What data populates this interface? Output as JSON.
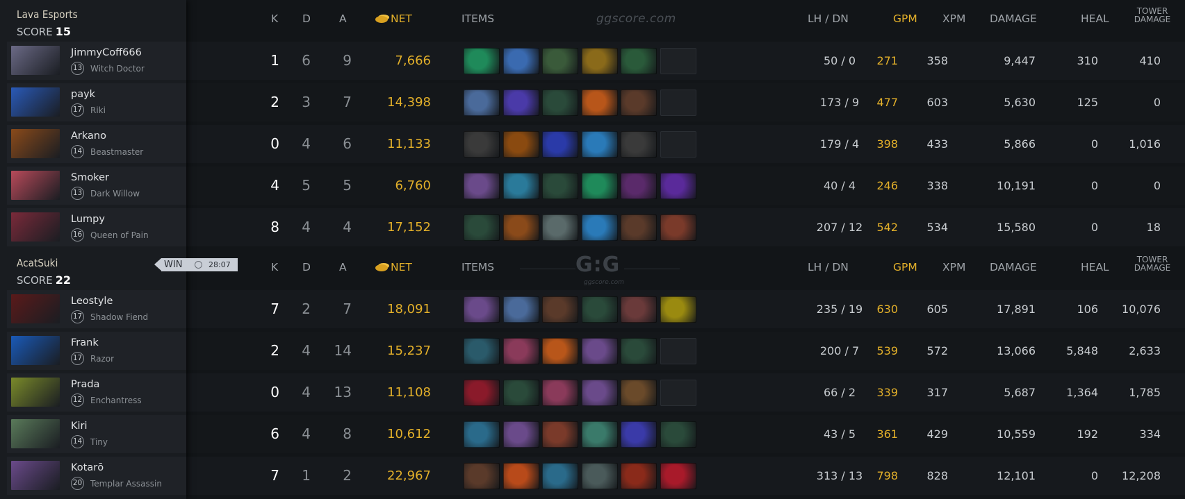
{
  "watermark_text": "ggscore.com",
  "watermark_logo": "G:G",
  "watermark_logo_sub": "ggscore.com",
  "headers": {
    "k": "K",
    "d": "D",
    "a": "A",
    "net": "NET",
    "items": "ITEMS",
    "lh_dn": "LH  /  DN",
    "gpm": "GPM",
    "xpm": "XPM",
    "damage": "DAMAGE",
    "heal": "HEAL",
    "tower_line1": "TOWER",
    "tower_line2": "DAMAGE"
  },
  "win_badge": {
    "label": "WIN",
    "duration": "28:07"
  },
  "teams": [
    {
      "name": "Lava Esports",
      "score_label": "SCORE",
      "score": "15",
      "players": [
        {
          "name": "JimmyCoff666",
          "level": "13",
          "hero": "Witch Doctor",
          "portrait_color": "#6b6a86",
          "k": "1",
          "d": "6",
          "a": "9",
          "net": "7,666",
          "lh_dn": "50  /  0",
          "gpm": "271",
          "xpm": "358",
          "damage": "9,447",
          "heal": "310",
          "tower": "410",
          "items": [
            "#1f8a5a",
            "#3a6ab0",
            "#3a5a3a",
            "#8a6a1a",
            "#2a5a3a",
            "empty"
          ]
        },
        {
          "name": "payk",
          "level": "17",
          "hero": "Riki",
          "portrait_color": "#2a5ab8",
          "k": "2",
          "d": "3",
          "a": "7",
          "net": "14,398",
          "lh_dn": "173  /  9",
          "gpm": "477",
          "xpm": "603",
          "damage": "5,630",
          "heal": "125",
          "tower": "0",
          "items": [
            "#4a6a9a",
            "#4a3aa8",
            "#2a4a3a",
            "#b8561a",
            "#5a3a2a",
            "empty"
          ]
        },
        {
          "name": "Arkano",
          "level": "14",
          "hero": "Beastmaster",
          "portrait_color": "#8a4a1a",
          "k": "0",
          "d": "4",
          "a": "6",
          "net": "11,133",
          "lh_dn": "179  /  4",
          "gpm": "398",
          "xpm": "433",
          "damage": "5,866",
          "heal": "0",
          "tower": "1,016",
          "items": [
            "#3a3a3a",
            "#8a4a10",
            "#2a3aa8",
            "#2a7ab8",
            "#3a3a3a",
            "empty"
          ]
        },
        {
          "name": "Smoker",
          "level": "13",
          "hero": "Dark Willow",
          "portrait_color": "#b84a5a",
          "k": "4",
          "d": "5",
          "a": "5",
          "net": "6,760",
          "lh_dn": "40  /  4",
          "gpm": "246",
          "xpm": "338",
          "damage": "10,191",
          "heal": "0",
          "tower": "0",
          "items": [
            "#6a4a8a",
            "#2a7a9a",
            "#2a4a3a",
            "#1f8a5a",
            "#5a2a6a",
            "#5a2a9a"
          ]
        },
        {
          "name": "Lumpy",
          "level": "16",
          "hero": "Queen of Pain",
          "portrait_color": "#7a2a3a",
          "k": "8",
          "d": "4",
          "a": "4",
          "net": "17,152",
          "lh_dn": "207  /  12",
          "gpm": "542",
          "xpm": "534",
          "damage": "15,580",
          "heal": "0",
          "tower": "18",
          "items": [
            "#2a4a3a",
            "#8a4a1a",
            "#5a6a6a",
            "#2a7ab8",
            "#5a3a2a",
            "#7a3a2a"
          ]
        }
      ]
    },
    {
      "name": "AcatSuki",
      "score_label": "SCORE",
      "score": "22",
      "players": [
        {
          "name": "Leostyle",
          "level": "17",
          "hero": "Shadow Fiend",
          "portrait_color": "#5a1a1a",
          "k": "7",
          "d": "2",
          "a": "7",
          "net": "18,091",
          "lh_dn": "235  /  19",
          "gpm": "630",
          "xpm": "605",
          "damage": "17,891",
          "heal": "106",
          "tower": "10,076",
          "items": [
            "#6a4a8a",
            "#4a6a9a",
            "#5a3a2a",
            "#2a4a3a",
            "#6a3a3a",
            "#9a8a10"
          ]
        },
        {
          "name": "Frank",
          "level": "17",
          "hero": "Razor",
          "portrait_color": "#1a5ab8",
          "k": "2",
          "d": "4",
          "a": "14",
          "net": "15,237",
          "lh_dn": "200  /  7",
          "gpm": "539",
          "xpm": "572",
          "damage": "13,066",
          "heal": "5,848",
          "tower": "2,633",
          "items": [
            "#2a5a6a",
            "#8a3a5a",
            "#b8561a",
            "#6a4a8a",
            "#2a4a3a",
            "empty"
          ]
        },
        {
          "name": "Prada",
          "level": "12",
          "hero": "Enchantress",
          "portrait_color": "#7a8a2a",
          "k": "0",
          "d": "4",
          "a": "13",
          "net": "11,108",
          "lh_dn": "66  /  2",
          "gpm": "339",
          "xpm": "317",
          "damage": "5,687",
          "heal": "1,364",
          "tower": "1,785",
          "items": [
            "#8a1a2a",
            "#2a4a3a",
            "#8a3a5a",
            "#6a4a8a",
            "#6a4a2a",
            "empty"
          ]
        },
        {
          "name": "Kiri",
          "level": "14",
          "hero": "Tiny",
          "portrait_color": "#5a7a5a",
          "k": "6",
          "d": "4",
          "a": "8",
          "net": "10,612",
          "lh_dn": "43  /  5",
          "gpm": "361",
          "xpm": "429",
          "damage": "10,559",
          "heal": "192",
          "tower": "334",
          "items": [
            "#2a6a8a",
            "#6a4a8a",
            "#7a3a2a",
            "#3a7a6a",
            "#3a3aa8",
            "#2a4a3a"
          ]
        },
        {
          "name": "Kotarō",
          "level": "20",
          "hero": "Templar Assassin",
          "portrait_color": "#6a4a8a",
          "k": "7",
          "d": "1",
          "a": "2",
          "net": "22,967",
          "lh_dn": "313  /  13",
          "gpm": "798",
          "xpm": "828",
          "damage": "12,101",
          "heal": "0",
          "tower": "12,208",
          "items": [
            "#5a3a2a",
            "#b84a1a",
            "#2a6a8a",
            "#4a5a5a",
            "#8a2a1a",
            "#a81a2a"
          ]
        }
      ]
    }
  ]
}
